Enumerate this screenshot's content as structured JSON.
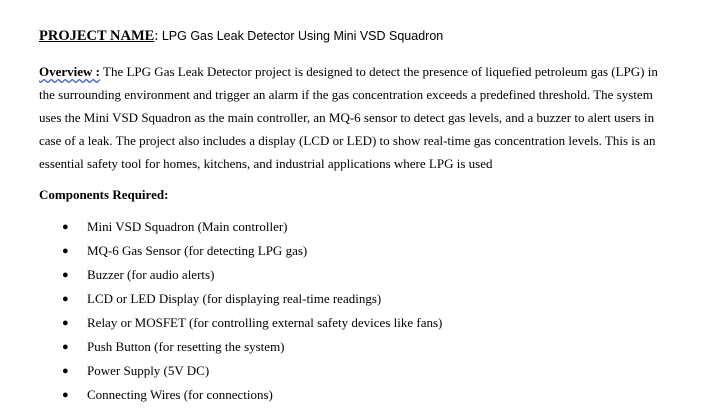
{
  "project": {
    "label": "PROJECT NAME",
    "separator": ":",
    "name": " LPG Gas Leak Detector Using Mini VSD Squadron"
  },
  "overview": {
    "label": "Overview :",
    "text": " The LPG Gas Leak Detector project is designed to detect the presence of liquefied petroleum gas (LPG) in the surrounding environment and trigger an alarm if the gas concentration exceeds a predefined threshold. The system uses the Mini VSD Squadron as the main controller, an MQ-6 sensor to detect gas levels, and a buzzer to alert users in case of a leak. The project also includes a display (LCD or LED) to show real-time gas concentration levels. This is an essential safety tool for homes, kitchens, and industrial applications where LPG is used"
  },
  "components": {
    "heading": "Components Required:",
    "bullet_glyph": "●",
    "items": [
      "Mini VSD Squadron (Main controller)",
      "MQ-6 Gas Sensor (for detecting LPG gas)",
      "Buzzer (for audio alerts)",
      "LCD or LED Display (for displaying real-time readings)",
      "Relay or MOSFET (for controlling external safety devices like fans)",
      "Push Button (for resetting the system)",
      "Power Supply (5V DC)",
      "Connecting Wires (for connections)"
    ]
  }
}
